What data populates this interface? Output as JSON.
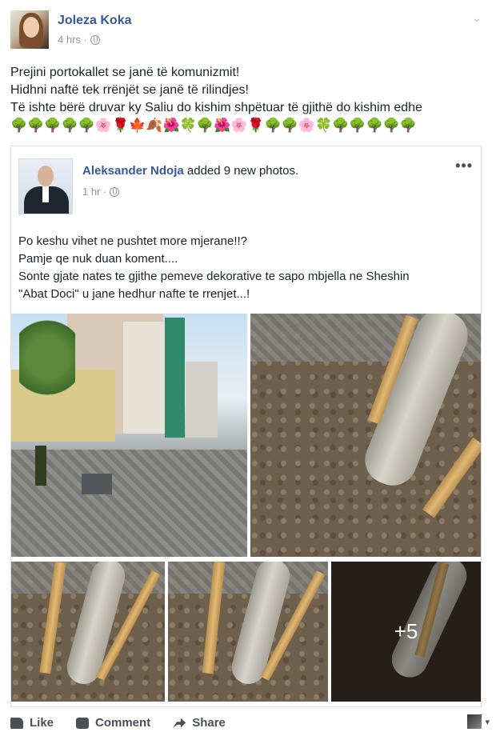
{
  "post": {
    "author": "Joleza Koka",
    "time": "4 hrs ·",
    "lines": [
      "Prejini portokallet se janë të komunizmit!",
      "Hidhni naftë tek rrënjët se janë të rilindjes!",
      "Të ishte bërë druvar ky Saliu do kishim shpëtuar të gjithë do kishim edhe"
    ],
    "emojis": "🌳🌳🌳🌳🌳🌸🌹🍁🍂🌺🍀🌳🌺🌸🌹🌳🌳🌸🍀🌳🌳🌳🌳🌳"
  },
  "shared": {
    "author": "Aleksander Ndoja",
    "action": " added 9 new photos.",
    "time": "1 hr ·",
    "more": "•••",
    "lines": [
      "Po keshu vihet ne pushtet more mjerane!!?",
      "Pamje qe nuk duan koment....",
      "Sonte gjate nates te gjithe pemeve dekorative te sapo mbjella ne Sheshin",
      "\"Abat Doci\" u jane hedhur nafte te rrenjet...!"
    ],
    "more_photos": "+5"
  },
  "actions": {
    "like": "Like",
    "comment": "Comment",
    "share": "Share"
  }
}
